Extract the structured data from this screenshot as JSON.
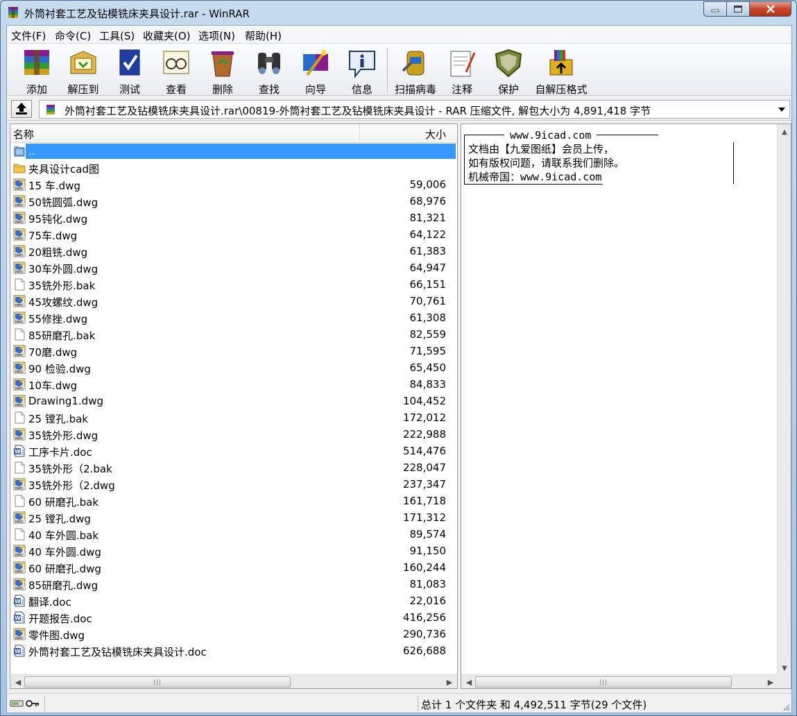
{
  "window": {
    "title": "外筒衬套工艺及钻模铣床夹具设计.rar - WinRAR"
  },
  "menu": [
    "文件(F)",
    "命令(C)",
    "工具(S)",
    "收藏夹(O)",
    "选项(N)",
    "帮助(H)"
  ],
  "toolbar": [
    {
      "label": "添加",
      "icon": "add-archive-icon"
    },
    {
      "label": "解压到",
      "icon": "extract-to-icon"
    },
    {
      "label": "测试",
      "icon": "test-icon"
    },
    {
      "label": "查看",
      "icon": "view-icon"
    },
    {
      "label": "删除",
      "icon": "delete-icon"
    },
    {
      "label": "查找",
      "icon": "find-icon"
    },
    {
      "label": "向导",
      "icon": "wizard-icon"
    },
    {
      "label": "信息",
      "icon": "info-icon"
    },
    {
      "label": "扫描病毒",
      "icon": "virus-scan-icon"
    },
    {
      "label": "注释",
      "icon": "comment-icon"
    },
    {
      "label": "保护",
      "icon": "protect-icon"
    },
    {
      "label": "自解压格式",
      "icon": "sfx-icon"
    }
  ],
  "address": {
    "path": "外筒衬套工艺及钻模铣床夹具设计.rar\\00819-外筒衬套工艺及钻模铣床夹具设计 - RAR 压缩文件, 解包大小为 4,891,418 字节"
  },
  "columns": {
    "name": "名称",
    "size": "大小"
  },
  "files": [
    {
      "name": "..",
      "size": "",
      "type": "up",
      "selected": true
    },
    {
      "name": "夹具设计cad图",
      "size": "",
      "type": "folder"
    },
    {
      "name": "15 车.dwg",
      "size": "59,006",
      "type": "dwg"
    },
    {
      "name": "50铣圆弧.dwg",
      "size": "68,976",
      "type": "dwg"
    },
    {
      "name": "95钝化.dwg",
      "size": "81,321",
      "type": "dwg"
    },
    {
      "name": "75车.dwg",
      "size": "64,122",
      "type": "dwg"
    },
    {
      "name": "20粗铣.dwg",
      "size": "61,383",
      "type": "dwg"
    },
    {
      "name": "30车外圆.dwg",
      "size": "64,947",
      "type": "dwg"
    },
    {
      "name": "35铣外形.bak",
      "size": "66,151",
      "type": "bak"
    },
    {
      "name": "45攻螺纹.dwg",
      "size": "70,761",
      "type": "dwg"
    },
    {
      "name": "55修挫.dwg",
      "size": "61,308",
      "type": "dwg"
    },
    {
      "name": "85研磨孔.bak",
      "size": "82,559",
      "type": "bak"
    },
    {
      "name": "70磨.dwg",
      "size": "71,595",
      "type": "dwg"
    },
    {
      "name": "90 检验.dwg",
      "size": "65,450",
      "type": "dwg"
    },
    {
      "name": "10车.dwg",
      "size": "84,833",
      "type": "dwg"
    },
    {
      "name": "Drawing1.dwg",
      "size": "104,452",
      "type": "dwg"
    },
    {
      "name": "25 镗孔.bak",
      "size": "172,012",
      "type": "bak"
    },
    {
      "name": "35铣外形.dwg",
      "size": "222,988",
      "type": "dwg"
    },
    {
      "name": "工序卡片.doc",
      "size": "514,476",
      "type": "doc"
    },
    {
      "name": "35铣外形（2.bak",
      "size": "228,047",
      "type": "bak"
    },
    {
      "name": "35铣外形（2.dwg",
      "size": "237,347",
      "type": "dwg"
    },
    {
      "name": "60 研磨孔.bak",
      "size": "161,718",
      "type": "bak"
    },
    {
      "name": "25 镗孔.dwg",
      "size": "171,312",
      "type": "dwg"
    },
    {
      "name": "40 车外圆.bak",
      "size": "89,574",
      "type": "bak"
    },
    {
      "name": "40 车外圆.dwg",
      "size": "91,150",
      "type": "dwg"
    },
    {
      "name": "60 研磨孔.dwg",
      "size": "160,244",
      "type": "dwg"
    },
    {
      "name": "85研磨孔.dwg",
      "size": "81,083",
      "type": "dwg"
    },
    {
      "name": "翻译.doc",
      "size": "22,016",
      "type": "doc"
    },
    {
      "name": "开题报告.doc",
      "size": "416,256",
      "type": "doc"
    },
    {
      "name": "零件图.dwg",
      "size": "290,736",
      "type": "dwg"
    },
    {
      "name": "外筒衬套工艺及钻模铣床夹具设计.doc",
      "size": "626,688",
      "type": "doc"
    }
  ],
  "comment": {
    "url": "www.9icad.com",
    "lines": [
      "文档由【九爱图纸】会员上传，",
      "如有版权问题，请联系我们删除。",
      "机械帝国：www.9icad.com"
    ]
  },
  "status": {
    "text": "总计 1 个文件夹 和 4,492,511 字节(29 个文件)"
  },
  "colors": {
    "selection": "#3399ff",
    "title_gradient_top": "#c7dbef"
  }
}
